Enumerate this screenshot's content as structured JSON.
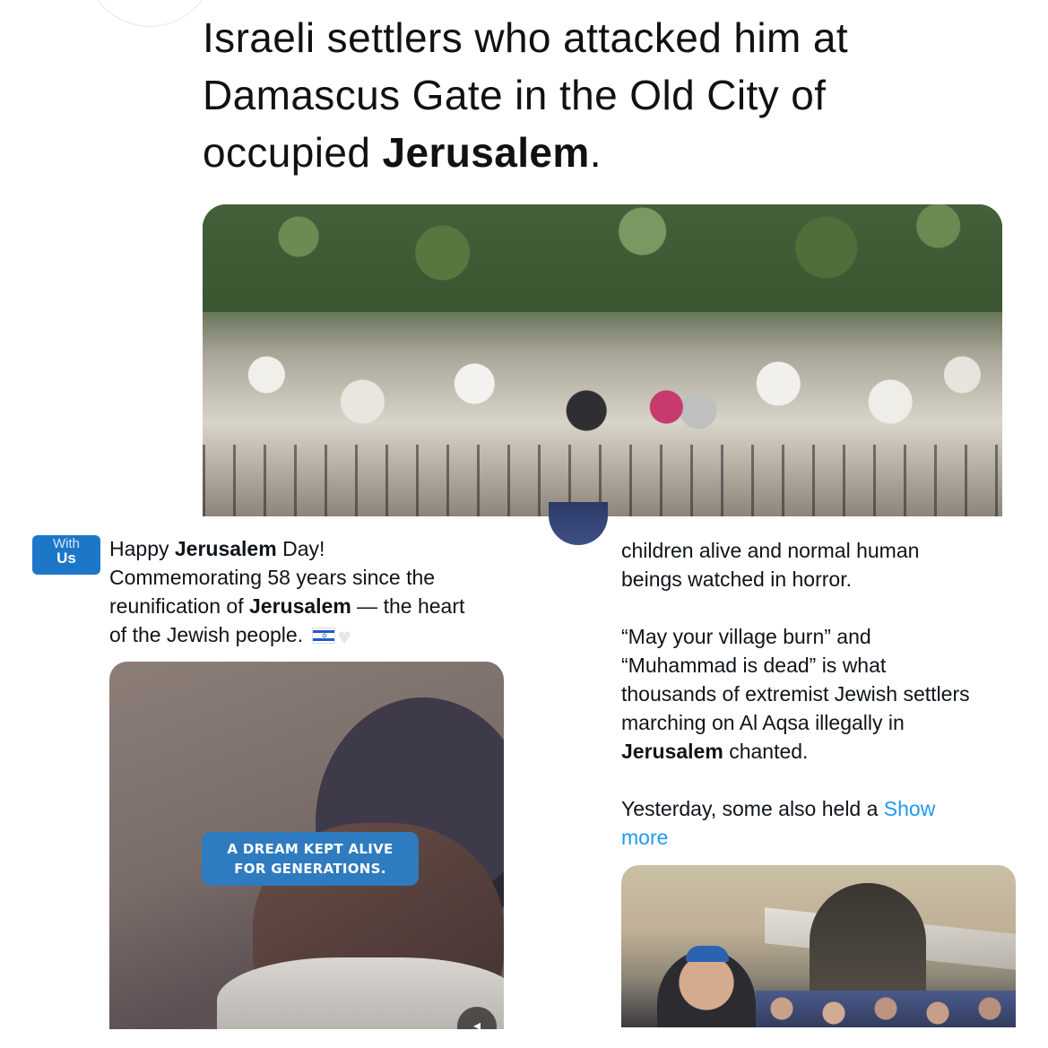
{
  "top_post": {
    "text_line1": "Israeli settlers who attacked him at",
    "text_line2": "Damascus Gate in the Old City of",
    "text_line3_prefix": "occupied ",
    "text_line3_bold": "Jerusalem",
    "text_line3_suffix": "."
  },
  "left_post": {
    "badge_top": "With",
    "badge_bottom": "Us",
    "line1_prefix": "Happy ",
    "line1_bold": "Jerusalem",
    "line1_suffix": " Day!",
    "line2": "Commemorating 58 years since the",
    "line3_prefix": "reunification of ",
    "line3_bold": "Jerusalem",
    "line3_suffix": " — the heart",
    "line4": "of the Jewish people.",
    "flag_icon": "israel-flag-icon",
    "heart_icon": "white-heart-icon",
    "video_caption_line1": "A DREAM KEPT ALIVE",
    "video_caption_line2": "FOR GENERATIONS."
  },
  "right_post": {
    "p1_line1": "children alive and normal human",
    "p1_line2": "beings watched in horror.",
    "p2_line1": "“May your village burn” and",
    "p2_line2": "“Muhammad is dead” is what",
    "p2_line3": "thousands of extremist Jewish settlers",
    "p2_line4": "marching on Al Aqsa illegally in",
    "p2_line5_bold": "Jerusalem",
    "p2_line5_suffix": " chanted.",
    "p3_text": "Yesterday, some also held a ",
    "show_more_part1": "Show",
    "show_more_part2": "more"
  },
  "colors": {
    "badge": "#1d77c8",
    "link": "#1d9bf0",
    "caption_bg": "#2e7bc0"
  }
}
